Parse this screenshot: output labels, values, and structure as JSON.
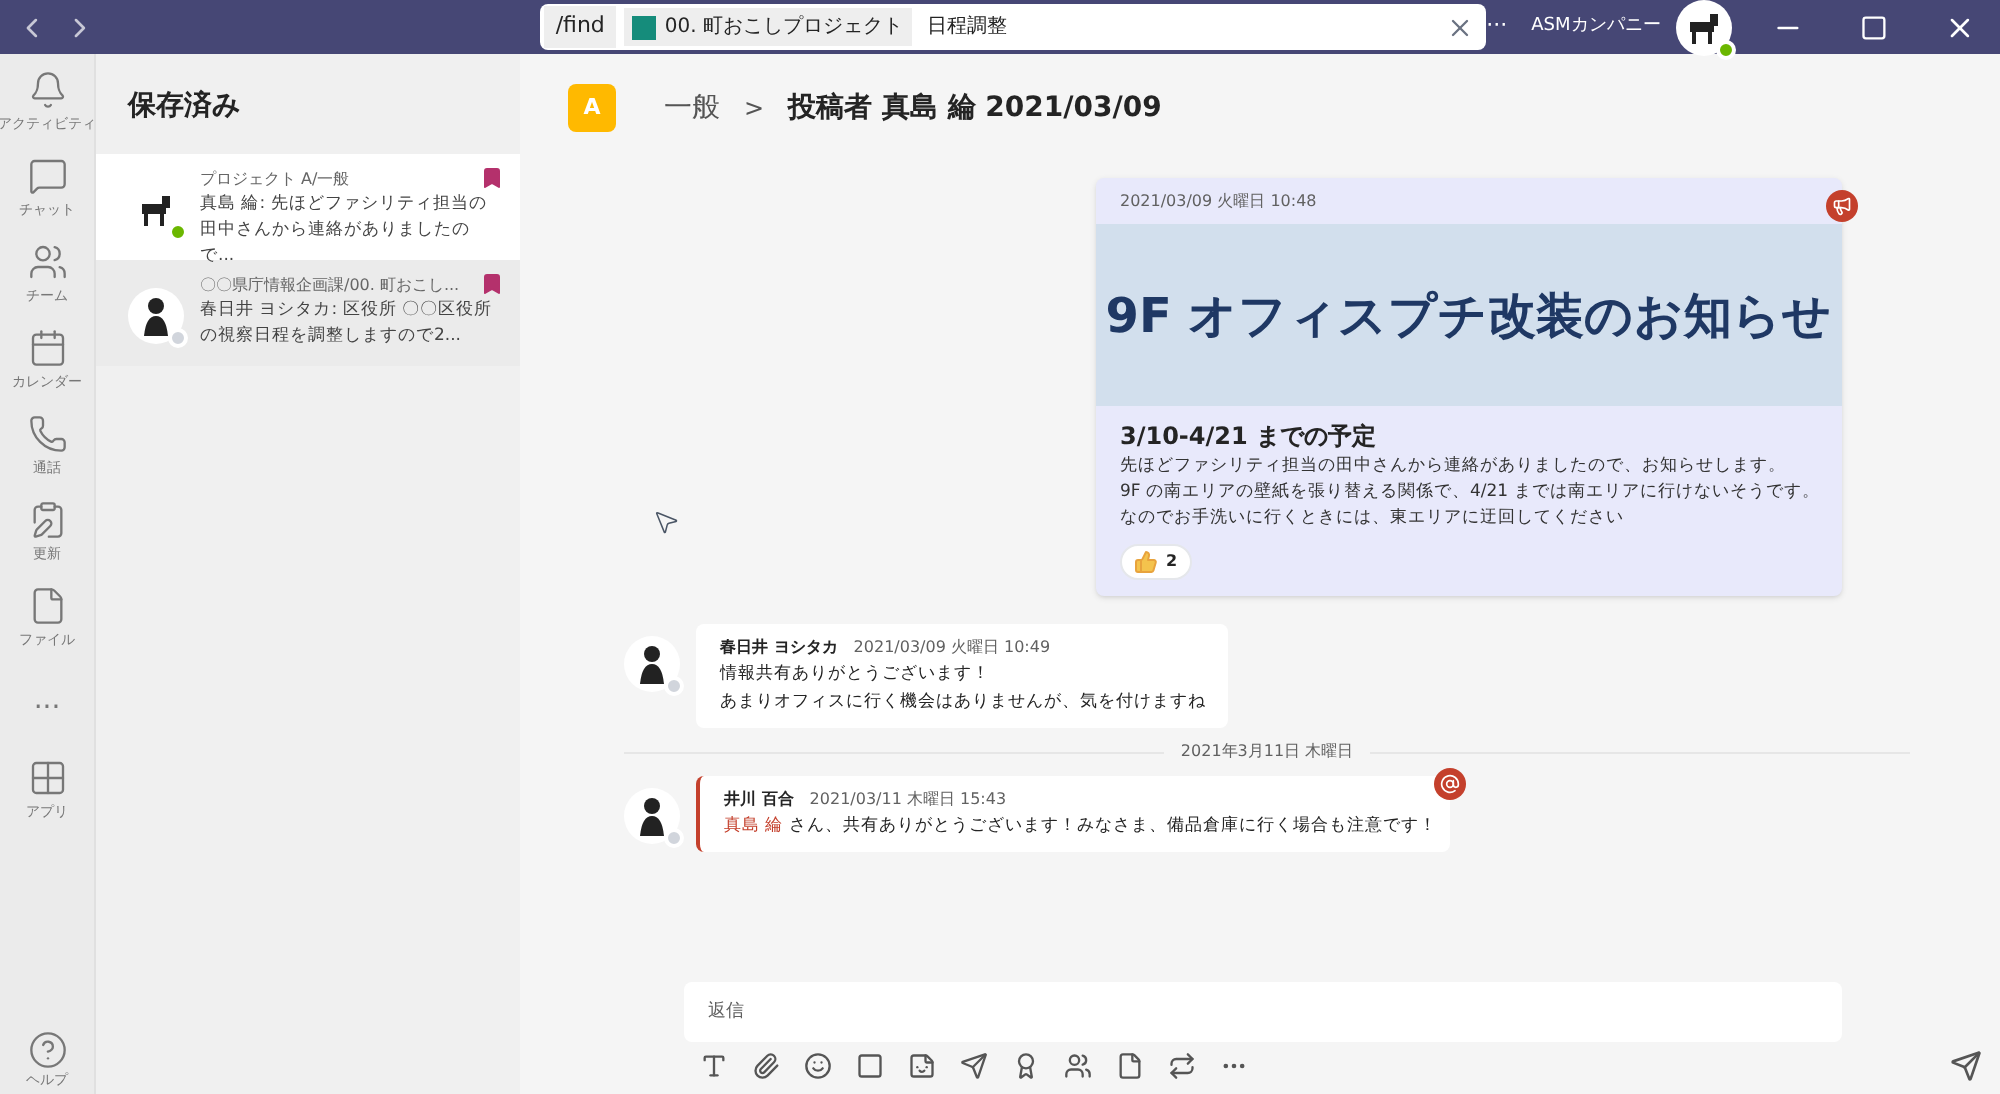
{
  "titlebar": {
    "search_command": "/find",
    "search_chip": "00. 町おこしプロジェクト",
    "search_value": "日程調整",
    "org": "ASMカンパニー",
    "more": "···"
  },
  "rail": [
    {
      "kind": "bell",
      "label": "アクティビティ"
    },
    {
      "kind": "chat",
      "label": "チャット"
    },
    {
      "kind": "teams",
      "label": "チーム"
    },
    {
      "kind": "calendar",
      "label": "カレンダー"
    },
    {
      "kind": "phone",
      "label": "通話"
    },
    {
      "kind": "update",
      "label": "更新"
    },
    {
      "kind": "file",
      "label": "ファイル"
    },
    {
      "kind": "more",
      "label": "···"
    },
    {
      "kind": "apps",
      "label": "アプリ"
    }
  ],
  "help": {
    "label": "ヘルプ"
  },
  "saved": {
    "title": "保存済み",
    "items": [
      {
        "selected": true,
        "channel": "プロジェクト A/一般",
        "preview": "真島 綸: 先ほどファシリティ担当の田中さんから連絡がありましたので...",
        "online": true
      },
      {
        "selected": false,
        "channel": "〇〇県庁情報企画課/00. 町おこし...",
        "preview": "春日井 ヨシタカ: 区役所 〇〇区役所の視察日程を調整しますので2...",
        "online": false
      }
    ]
  },
  "header": {
    "badge": "A",
    "channel": "一般",
    "separator": ">",
    "title": "投稿者 真島 綸 2021/03/09"
  },
  "announcement": {
    "timestamp": "2021/03/09 火曜日 10:48",
    "headline": "9F オフィスプチ改装のお知らせ",
    "subhead": "3/10-4/21 までの予定",
    "lines": [
      "先ほどファシリティ担当の田中さんから連絡がありましたので、お知らせします。",
      "9F の南エリアの壁紙を張り替える関係で、4/21 までは南エリアに行けないそうです。",
      "なのでお手洗いに行くときには、東エリアに迂回してください"
    ],
    "reaction_count": "2"
  },
  "replies": [
    {
      "author": "春日井 ヨシタカ",
      "time": "2021/03/09 火曜日 10:49",
      "lines": [
        "情報共有ありがとうございます！",
        "あまりオフィスに行く機会はありませんが、気を付けますね"
      ],
      "kind": "plain"
    },
    {
      "divider": "2021年3月11日 木曜日"
    },
    {
      "author": "井川 百合",
      "time": "2021/03/11 木曜日 15:43",
      "mention": "真島 綸",
      "lines": [
        " さん、共有ありがとうございます！みなさま、備品倉庫に行く場合も注意です！"
      ],
      "kind": "mention"
    }
  ],
  "compose": {
    "placeholder": "返信"
  }
}
